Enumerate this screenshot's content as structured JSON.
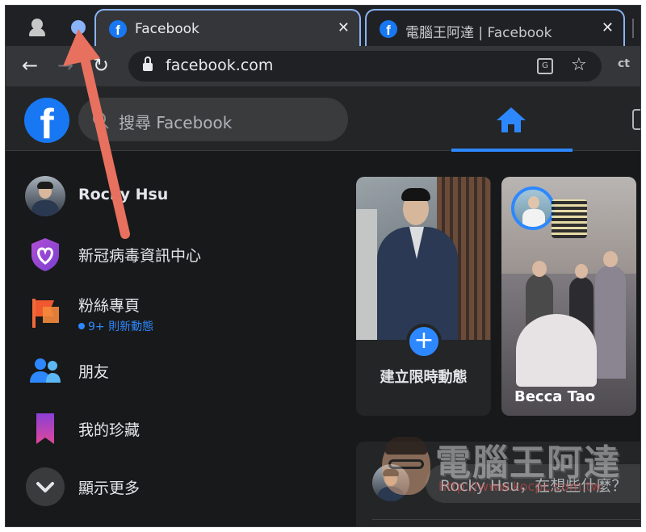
{
  "browser": {
    "tabs": [
      {
        "title": "Facebook",
        "close_glyph": "✕",
        "favicon": "f"
      },
      {
        "title": "電腦王阿達 | Facebook",
        "close_glyph": "✕",
        "favicon": "f"
      }
    ],
    "nav": {
      "back": "←",
      "forward": "→",
      "reload": "↻"
    },
    "url": "facebook.com",
    "toolbar_icons": {
      "translate": "G",
      "bookmark": "☆",
      "extension": "ct"
    }
  },
  "header": {
    "logo": "f",
    "search_placeholder": "搜尋 Facebook"
  },
  "sidebar": {
    "items": [
      {
        "label": "Rocky Hsu",
        "icon": "avatar"
      },
      {
        "label": "新冠病毒資訊中心",
        "icon": "covid-heart-shield-icon"
      },
      {
        "label": "粉絲專頁",
        "sub": "9+ 則新動態",
        "icon": "pages-flag-icon"
      },
      {
        "label": "朋友",
        "icon": "friends-icon"
      },
      {
        "label": "我的珍藏",
        "icon": "bookmark-ribbon-icon"
      },
      {
        "label": "顯示更多",
        "icon": "chevron-down-icon"
      }
    ]
  },
  "stories": {
    "create": {
      "plus": "+",
      "label": "建立限時動態"
    },
    "friend": {
      "name": "Becca Tao"
    }
  },
  "composer": {
    "placeholder": "Rocky Hsu，在想些什麼？"
  },
  "watermark": {
    "title": "電腦王阿達",
    "url": "http://www.kocpc.com.tw"
  },
  "colors": {
    "fb_blue": "#1877f2",
    "accent_blue": "#2d88ff",
    "annotation_arrow": "#e8705f",
    "tab_border": "#8ab4f8"
  }
}
